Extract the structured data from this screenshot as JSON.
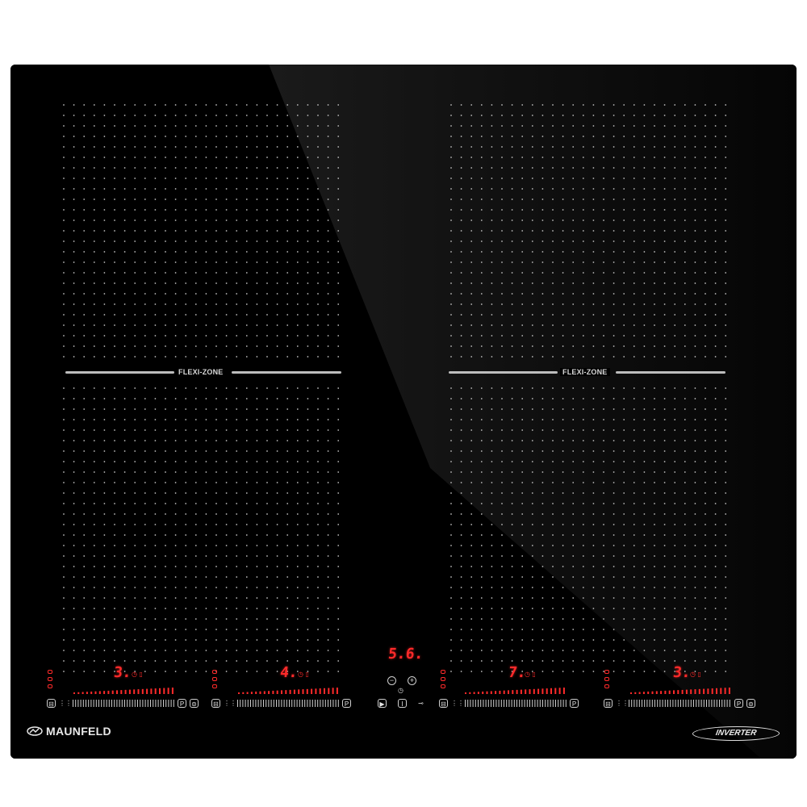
{
  "brand": {
    "name": "MAUNFELD",
    "logo_icon": "maunfeld-logo-icon"
  },
  "badge": {
    "label": "INVERTER"
  },
  "flexi_zones": [
    {
      "label": "FLEXI-ZONE"
    },
    {
      "label": "FLEXI-ZONE"
    }
  ],
  "timer": {
    "display": "5.6."
  },
  "burners": [
    {
      "level": "3.",
      "power_level": 3
    },
    {
      "level": "4.",
      "power_level": 4
    },
    {
      "level": "7.",
      "power_level": 7
    },
    {
      "level": "3.",
      "power_level": 3
    }
  ],
  "controls": {
    "minus_label": "−",
    "plus_label": "+",
    "power_label": "I",
    "pause_label": "▶",
    "lock_label": "⊸",
    "boost_label": "P",
    "timer_icon": "clock-icon",
    "keep_warm_icon": "pot-icon",
    "bridge_icon": "bridge-icon"
  },
  "colors": {
    "glass": "#000000",
    "display": "#ff2a2a",
    "print": "#cfcfcf"
  }
}
